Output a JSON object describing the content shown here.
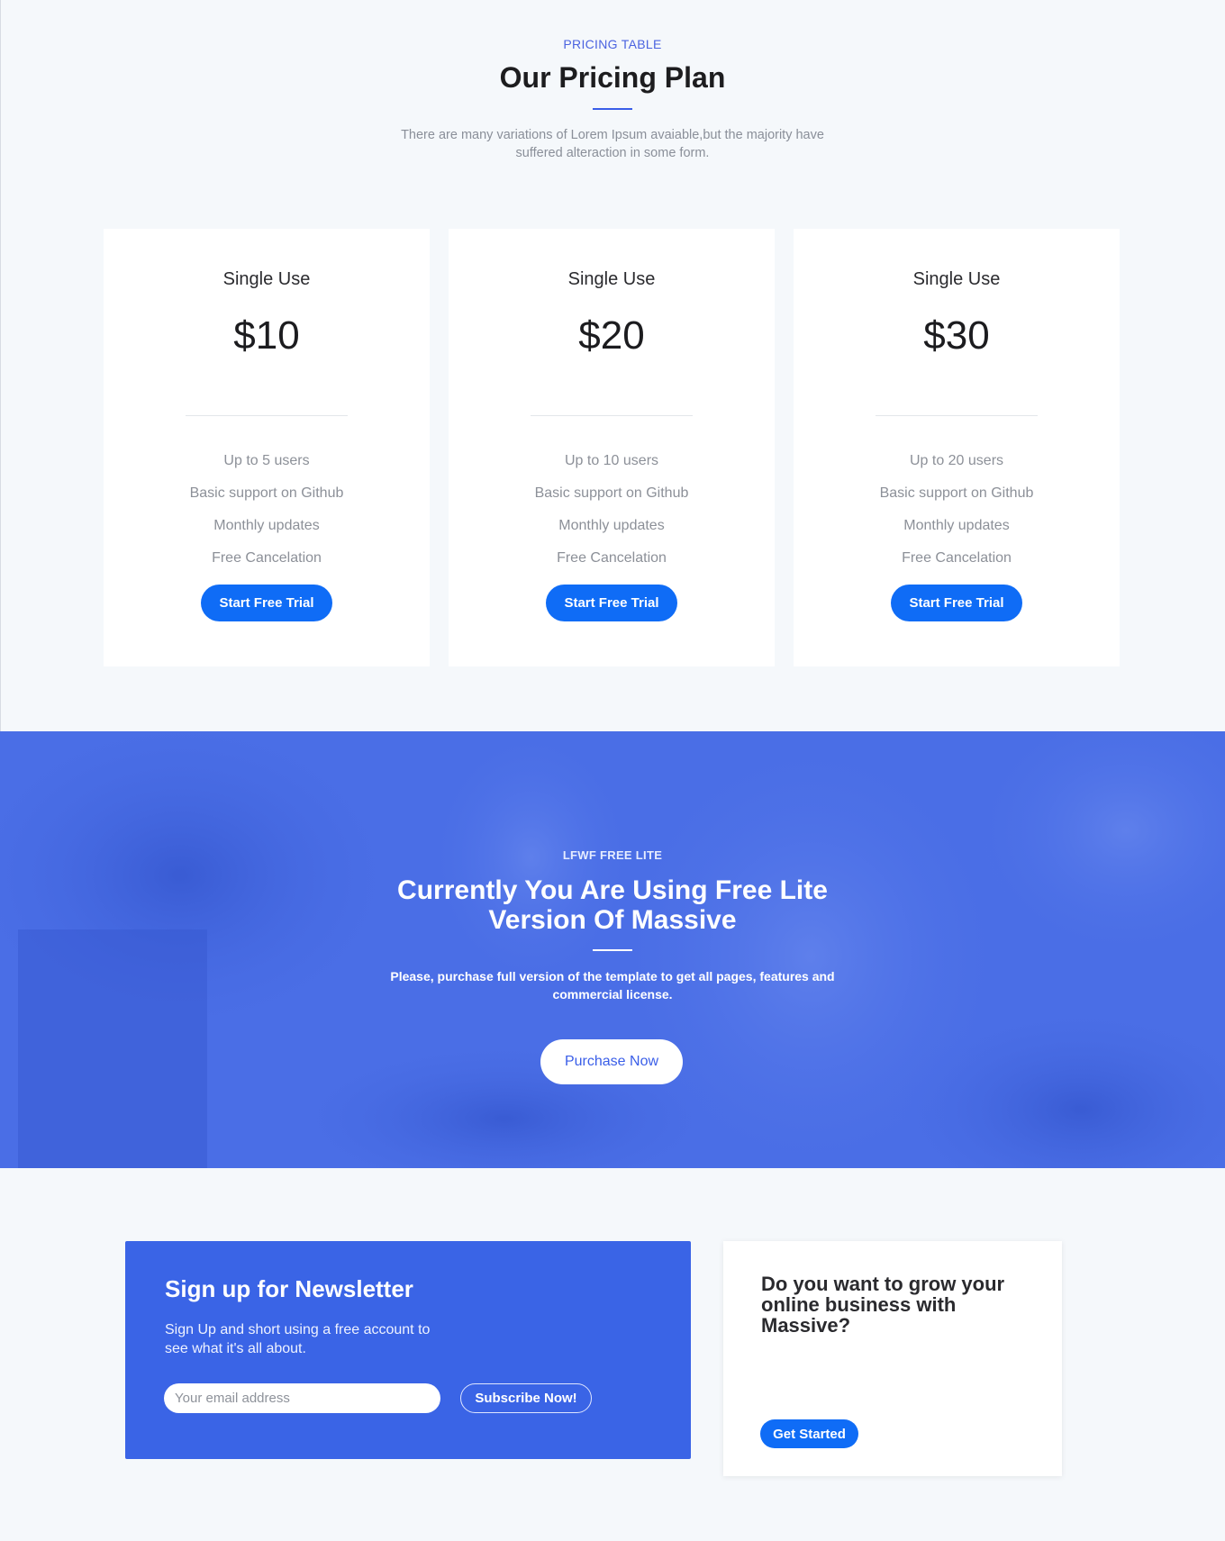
{
  "pricing": {
    "eyebrow": "PRICING TABLE",
    "title": "Our Pricing Plan",
    "description": "There are many variations of Lorem Ipsum avaiable,but the majority have suffered alteraction in some form.",
    "plans": [
      {
        "name": "Single Use",
        "price": "$10",
        "features": [
          "Up to 5 users",
          "Basic support on Github",
          "Monthly updates",
          "Free Cancelation"
        ],
        "button": "Start Free Trial"
      },
      {
        "name": "Single Use",
        "price": "$20",
        "features": [
          "Up to 10 users",
          "Basic support on Github",
          "Monthly updates",
          "Free Cancelation"
        ],
        "button": "Start Free Trial"
      },
      {
        "name": "Single Use",
        "price": "$30",
        "features": [
          "Up to 20 users",
          "Basic support on Github",
          "Monthly updates",
          "Free Cancelation"
        ],
        "button": "Start Free Trial"
      }
    ]
  },
  "banner": {
    "eyebrow": "LFWF FREE LITE",
    "title": "Currently You Are Using Free Lite Version Of Massive",
    "description": "Please, purchase full version of the template to get all pages, features and commercial license.",
    "button": "Purchase Now"
  },
  "newsletter": {
    "title": "Sign up for Newsletter",
    "description": "Sign Up and short using a free account to see what it's all about.",
    "email_placeholder": "Your email address",
    "button": "Subscribe Now!"
  },
  "grow": {
    "title": "Do you want to grow your online business with Massive?",
    "button": "Get Started"
  },
  "colors": {
    "accent": "#0f6cf6",
    "brand_blue": "#3a64e6",
    "banner_overlay": "#4a6ee6",
    "page_bg": "#f5f8fb"
  }
}
